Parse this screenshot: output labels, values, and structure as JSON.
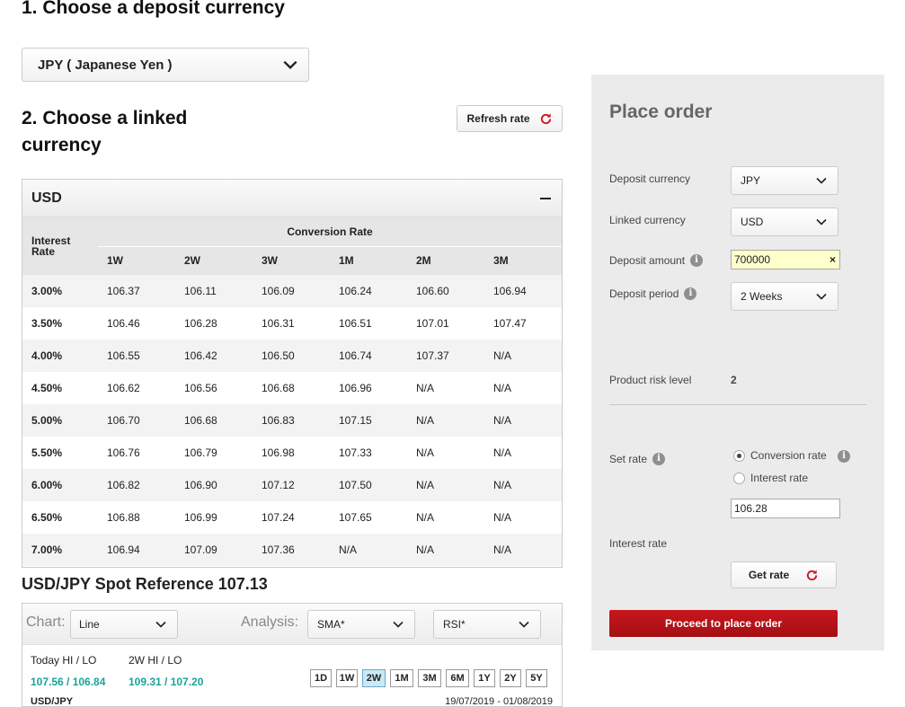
{
  "step1": {
    "heading": "1. Choose a deposit currency",
    "deposit_currency": "JPY ( Japanese Yen )"
  },
  "step2": {
    "heading_line1": "2. Choose a linked",
    "heading_line2": "currency",
    "refresh_label": "Refresh rate"
  },
  "rate_table": {
    "currency": "USD",
    "interest_rate_header_line1": "Interest",
    "interest_rate_header_line2": "Rate",
    "conversion_header": "Conversion Rate",
    "periods": [
      "1W",
      "2W",
      "3W",
      "1M",
      "2M",
      "3M"
    ],
    "rows": [
      {
        "rate": "3.00%",
        "values": [
          "106.37",
          "106.11",
          "106.09",
          "106.24",
          "106.60",
          "106.94"
        ]
      },
      {
        "rate": "3.50%",
        "values": [
          "106.46",
          "106.28",
          "106.31",
          "106.51",
          "107.01",
          "107.47"
        ]
      },
      {
        "rate": "4.00%",
        "values": [
          "106.55",
          "106.42",
          "106.50",
          "106.74",
          "107.37",
          "N/A"
        ]
      },
      {
        "rate": "4.50%",
        "values": [
          "106.62",
          "106.56",
          "106.68",
          "106.96",
          "N/A",
          "N/A"
        ]
      },
      {
        "rate": "5.00%",
        "values": [
          "106.70",
          "106.68",
          "106.83",
          "107.15",
          "N/A",
          "N/A"
        ]
      },
      {
        "rate": "5.50%",
        "values": [
          "106.76",
          "106.79",
          "106.98",
          "107.33",
          "N/A",
          "N/A"
        ]
      },
      {
        "rate": "6.00%",
        "values": [
          "106.82",
          "106.90",
          "107.12",
          "107.50",
          "N/A",
          "N/A"
        ]
      },
      {
        "rate": "6.50%",
        "values": [
          "106.88",
          "106.99",
          "107.24",
          "107.65",
          "N/A",
          "N/A"
        ]
      },
      {
        "rate": "7.00%",
        "values": [
          "106.94",
          "107.09",
          "107.36",
          "N/A",
          "N/A",
          "N/A"
        ]
      }
    ]
  },
  "spot": {
    "title": "USD/JPY Spot Reference 107.13"
  },
  "chart_controls": {
    "chart_label": "Chart:",
    "chart_type": "Line",
    "analysis_label": "Analysis:",
    "analysis_1": "SMA*",
    "analysis_2": "RSI*",
    "today_label": "Today HI / LO",
    "today_value": "107.56 / 106.84",
    "period_label": "2W HI / LO",
    "period_value": "109.31 / 107.20",
    "ranges": [
      "1D",
      "1W",
      "2W",
      "1M",
      "3M",
      "6M",
      "1Y",
      "2Y",
      "5Y"
    ],
    "active_range": "2W",
    "pair": "USD/JPY",
    "date_range": "19/07/2019 - 01/08/2019"
  },
  "order": {
    "title": "Place order",
    "deposit_currency_label": "Deposit currency",
    "deposit_currency_value": "JPY",
    "linked_currency_label": "Linked currency",
    "linked_currency_value": "USD",
    "deposit_amount_label": "Deposit amount",
    "deposit_amount_value": "700000",
    "deposit_period_label": "Deposit period",
    "deposit_period_value": "2 Weeks",
    "risk_label": "Product risk level",
    "risk_value": "2",
    "set_rate_label": "Set rate",
    "option_conversion": "Conversion rate",
    "option_interest": "Interest rate",
    "rate_value": "106.28",
    "interest_rate_label": "Interest rate",
    "get_rate_label": "Get rate",
    "proceed_label": "Proceed to place order"
  },
  "colors": {
    "accent_red": "#c8161d",
    "teal": "#1aa39a",
    "panel_grey": "#ebebeb"
  }
}
